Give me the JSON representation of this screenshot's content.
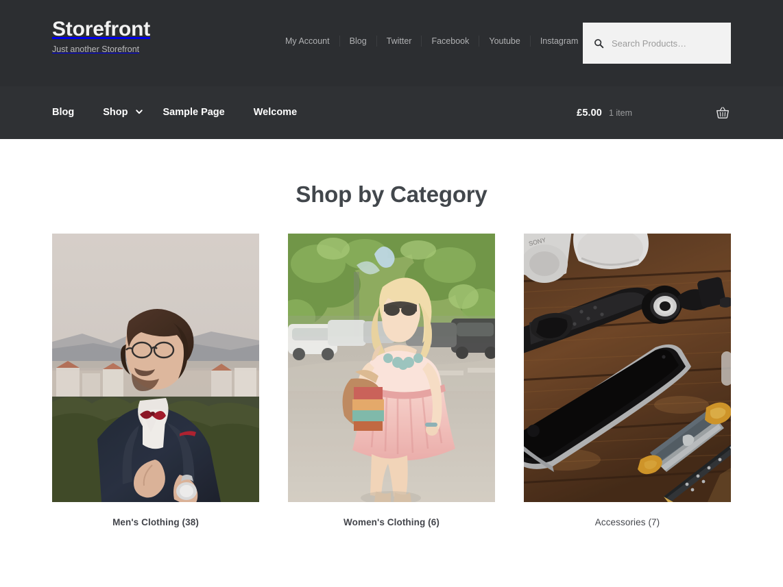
{
  "header": {
    "brand_title": "Storefront",
    "brand_tagline": "Just another Storefront",
    "secondary_nav": [
      {
        "label": "My Account"
      },
      {
        "label": "Blog"
      },
      {
        "label": "Twitter"
      },
      {
        "label": "Facebook"
      },
      {
        "label": "Youtube"
      },
      {
        "label": "Instagram"
      }
    ],
    "search": {
      "placeholder": "Search Products…",
      "value": "",
      "icon": "search-icon"
    },
    "colors": {
      "header_bg": "#2c2e31",
      "nav_bg": "#2f3134",
      "search_bg": "#f2f2f2",
      "text_light": "#f2f2f2",
      "text_muted": "#b0b1b3"
    }
  },
  "primary_nav": {
    "items": [
      {
        "label": "Blog",
        "has_children": false
      },
      {
        "label": "Shop",
        "has_children": true,
        "icon": "chevron-down-icon"
      },
      {
        "label": "Sample Page",
        "has_children": false
      },
      {
        "label": "Welcome",
        "has_children": false
      }
    ]
  },
  "cart": {
    "amount": "£5.00",
    "count": "1 item",
    "icon": "basket-icon"
  },
  "main": {
    "page_title": "Shop by Category",
    "categories": [
      {
        "name": "Men's Clothing",
        "count": "(38)",
        "label": "Men's Clothing (38)",
        "bold": true,
        "image_alt": "man-in-navy-suit-with-red-bow-tie"
      },
      {
        "name": "Women's Clothing",
        "count": "(6)",
        "label": "Women's Clothing (6)",
        "bold": true,
        "image_alt": "blonde-woman-in-pink-dress-on-street"
      },
      {
        "name": "Accessories",
        "count": "(7)",
        "label": "Accessories (7)",
        "bold": false,
        "image_alt": "phone-watch-headphones-on-wooden-table"
      }
    ]
  }
}
